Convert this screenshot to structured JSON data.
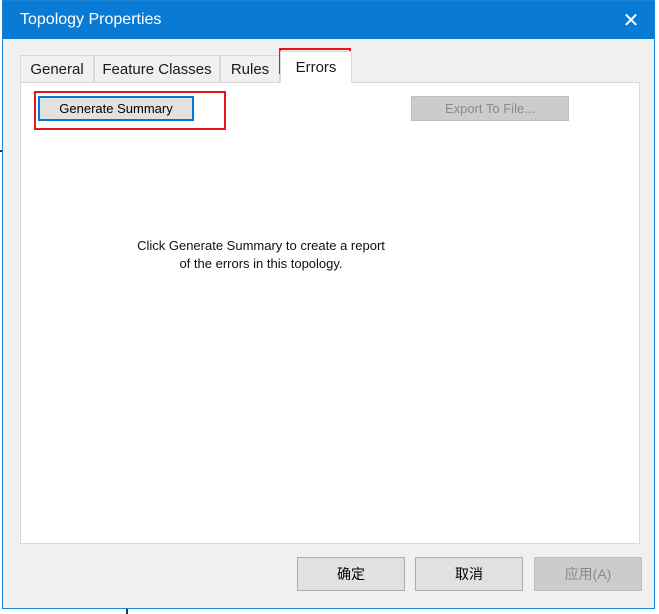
{
  "window": {
    "title": "Topology Properties",
    "close_glyph": "✕"
  },
  "tabs": [
    {
      "label": "General"
    },
    {
      "label": "Feature Classes"
    },
    {
      "label": "Rules"
    },
    {
      "label": "Errors",
      "selected": true
    }
  ],
  "errors_panel": {
    "generate_summary_label": "Generate Summary",
    "export_label": "Export To File...",
    "message_line1": "Click Generate Summary to create a report",
    "message_line2": "of the errors in this topology."
  },
  "footer": {
    "ok_label": "确定",
    "cancel_label": "取消",
    "apply_label": "应用(A)"
  },
  "colors": {
    "title_bar": "#0a7bd4",
    "annotation_highlight": "#e4161c"
  }
}
